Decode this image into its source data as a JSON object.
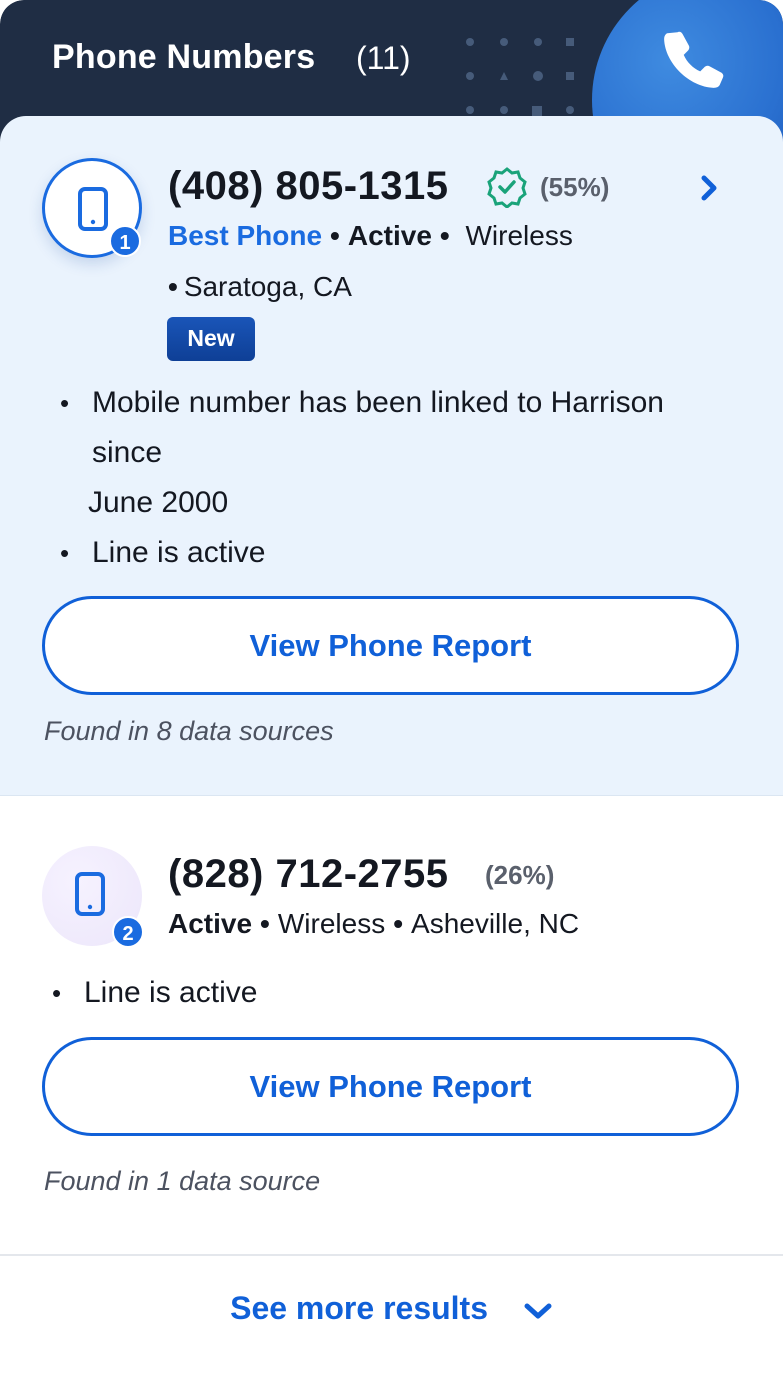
{
  "header": {
    "title": "Phone Numbers",
    "count": "(11)",
    "icon": "phone-handset-icon"
  },
  "results": [
    {
      "rank": "1",
      "phone": "(408) 805-1315",
      "verified_icon": "verified-badge-icon",
      "match_pct": "(55%)",
      "best_label": "Best Phone",
      "status": "Active",
      "line_type": "Wireless",
      "location": "Saratoga, CA",
      "badge": "New",
      "bullets": {
        "linked_line1": "Mobile number has been linked to Harrison",
        "linked_line2": "since",
        "linked_line3": "June 2000",
        "active": "Line is active"
      },
      "button_label": "View Phone Report",
      "sources": "Found in 8 data sources"
    },
    {
      "rank": "2",
      "phone": "(828) 712-2755",
      "match_pct": "(26%)",
      "status": "Active",
      "line_type": "Wireless",
      "location": "Asheville, NC",
      "bullets": {
        "active": "Line is active"
      },
      "button_label": "View Phone Report",
      "sources": "Found in 1 data source"
    }
  ],
  "footer": {
    "see_more": "See more results"
  },
  "colors": {
    "header_bg": "#1f2d44",
    "accent": "#1060d8",
    "first_result_bg": "#eaf3fd",
    "verified": "#1aa37a"
  }
}
